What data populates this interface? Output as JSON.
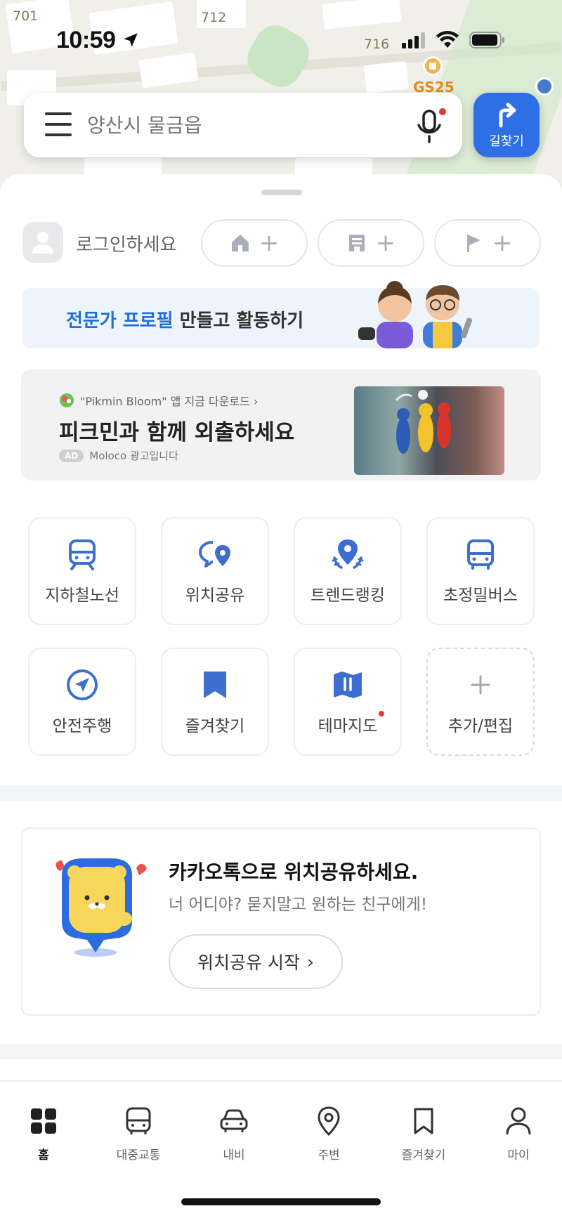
{
  "status_bar": {
    "time": "10:59"
  },
  "map": {
    "labels": [
      "701",
      "712",
      "716"
    ],
    "poi_gs25": "GS25"
  },
  "search": {
    "placeholder": "양산시 물금읍",
    "route_button_label": "길찾기"
  },
  "login": {
    "prompt": "로그인하세요",
    "shortcut_plus": "+"
  },
  "expert_banner": {
    "highlight": "전문가 프로필",
    "rest": " 만들고 활동하기"
  },
  "ad": {
    "subtitle": "\"Pikmin Bloom\" 앱 지금 다운로드 ›",
    "title": "피크민과 함께 외출하세요",
    "badge": "AD",
    "advertiser": "Moloco 광고입니다"
  },
  "shortcuts": [
    {
      "label": "지하철노선",
      "icon": "subway-icon"
    },
    {
      "label": "위치공유",
      "icon": "location-share-icon"
    },
    {
      "label": "트렌드랭킹",
      "icon": "trend-ranking-icon"
    },
    {
      "label": "초정밀버스",
      "icon": "bus-icon"
    },
    {
      "label": "안전주행",
      "icon": "safe-drive-icon"
    },
    {
      "label": "즐겨찾기",
      "icon": "bookmark-icon"
    },
    {
      "label": "테마지도",
      "icon": "theme-map-icon",
      "new": true
    },
    {
      "label": "추가/편집",
      "icon": "plus-icon"
    }
  ],
  "share_card": {
    "title": "카카오톡으로 위치공유하세요.",
    "subtitle": "너 어디야? 묻지말고 원하는 친구에게!",
    "button": "위치공유 시작",
    "button_chevron": "›"
  },
  "tabs": [
    {
      "label": "홈",
      "icon": "home-grid-icon",
      "active": true
    },
    {
      "label": "대중교통",
      "icon": "bus-icon",
      "active": false
    },
    {
      "label": "내비",
      "icon": "car-icon",
      "active": false
    },
    {
      "label": "주변",
      "icon": "pin-icon",
      "active": false
    },
    {
      "label": "즐겨찾기",
      "icon": "bookmark-icon",
      "active": false
    },
    {
      "label": "마이",
      "icon": "person-icon",
      "active": false
    }
  ],
  "colors": {
    "accent_blue": "#2f6fe6",
    "icon_blue": "#3e6fd0",
    "notice_red": "#e53935"
  }
}
